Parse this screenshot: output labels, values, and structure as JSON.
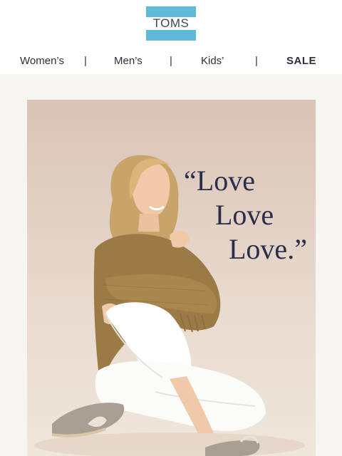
{
  "brand": {
    "logo_text": "TOMS"
  },
  "nav": {
    "items": [
      {
        "label": "Women’s"
      },
      {
        "label": "Men’s"
      },
      {
        "label": "Kids’"
      },
      {
        "label": "SALE"
      }
    ],
    "separator": "|"
  },
  "hero": {
    "quote_line1": "“Love",
    "quote_line2": "Love",
    "quote_line3": "Love.”",
    "colors": {
      "background": "#e4d3c6",
      "quote": "#2b2d4a",
      "sweater": "#9b7a45",
      "pants": "#ffffff"
    }
  },
  "colors": {
    "logo_blue": "#5fb9d8",
    "page_bg": "#f7f5f2"
  }
}
